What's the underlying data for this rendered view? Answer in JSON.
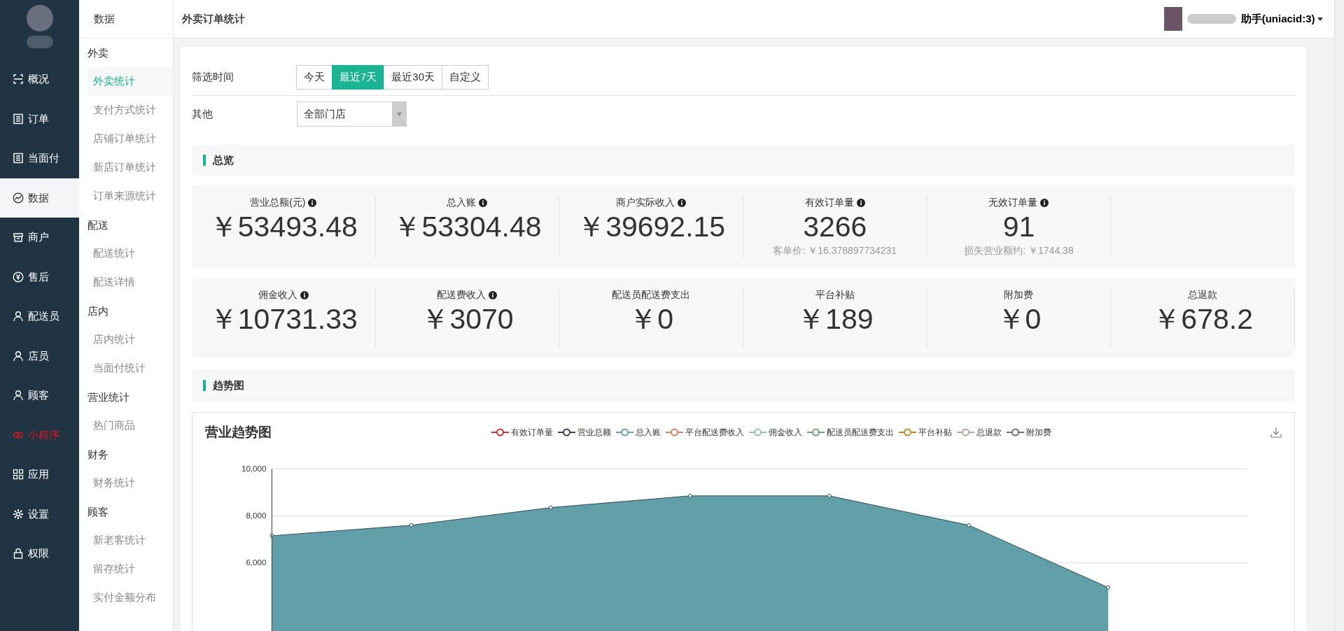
{
  "nav": [
    {
      "label": "概况",
      "selected": false,
      "hot": false
    },
    {
      "label": "订单",
      "selected": false,
      "hot": false
    },
    {
      "label": "当面付",
      "selected": false,
      "hot": false
    },
    {
      "label": "数据",
      "selected": true,
      "hot": false
    },
    {
      "label": "商户",
      "selected": false,
      "hot": false
    },
    {
      "label": "售后",
      "selected": false,
      "hot": false
    },
    {
      "label": "配送员",
      "selected": false,
      "hot": false
    },
    {
      "label": "店员",
      "selected": false,
      "hot": false
    },
    {
      "label": "顾客",
      "selected": false,
      "hot": false
    },
    {
      "label": "小程序",
      "selected": false,
      "hot": true
    },
    {
      "label": "应用",
      "selected": false,
      "hot": false
    },
    {
      "label": "设置",
      "selected": false,
      "hot": false
    },
    {
      "label": "权限",
      "selected": false,
      "hot": false
    }
  ],
  "subnav": {
    "title": "数据",
    "groups": [
      {
        "title": "外卖",
        "items": [
          {
            "label": "外卖统计",
            "selected": true
          },
          {
            "label": "支付方式统计",
            "selected": false
          },
          {
            "label": "店铺订单统计",
            "selected": false
          },
          {
            "label": "新店订单统计",
            "selected": false
          },
          {
            "label": "订单来源统计",
            "selected": false
          }
        ]
      },
      {
        "title": "配送",
        "items": [
          {
            "label": "配送统计",
            "selected": false
          },
          {
            "label": "配送详情",
            "selected": false
          }
        ]
      },
      {
        "title": "店内",
        "items": [
          {
            "label": "店内统计",
            "selected": false
          },
          {
            "label": "当面付统计",
            "selected": false
          }
        ]
      },
      {
        "title": "营业统计",
        "items": [
          {
            "label": "热门商品",
            "selected": false
          }
        ]
      },
      {
        "title": "财务",
        "items": [
          {
            "label": "财务统计",
            "selected": false
          }
        ]
      },
      {
        "title": "顾客",
        "items": [
          {
            "label": "新老客统计",
            "selected": false
          },
          {
            "label": "留存统计",
            "selected": false
          },
          {
            "label": "实付金额分布",
            "selected": false
          }
        ]
      }
    ]
  },
  "header": {
    "title": "外卖订单统计",
    "user": "助手(uniacid:3)"
  },
  "filters": {
    "time_label": "筛选时间",
    "ranges": [
      {
        "label": "今天",
        "selected": false
      },
      {
        "label": "最近7天",
        "selected": true
      },
      {
        "label": "最近30天",
        "selected": false
      },
      {
        "label": "自定义",
        "selected": false
      }
    ],
    "other_label": "其他",
    "store_select": "全部门店"
  },
  "overview": {
    "title": "总览",
    "rows": [
      [
        {
          "label": "营业总额(元)",
          "info": true,
          "value": "￥53493.48"
        },
        {
          "label": "总入账",
          "info": true,
          "value": "￥53304.48"
        },
        {
          "label": "商户实际收入",
          "info": true,
          "value": "￥39692.15"
        },
        {
          "label": "有效订单量",
          "info": true,
          "value": "3266",
          "note": "客单价: ￥16.378897734231"
        },
        {
          "label": "无效订单量",
          "info": true,
          "value": "91",
          "note": "损失营业额约: ￥1744.38"
        }
      ],
      [
        {
          "label": "佣金收入",
          "info": true,
          "value": "￥10731.33"
        },
        {
          "label": "配送费收入",
          "info": true,
          "value": "￥3070"
        },
        {
          "label": "配送员配送费支出",
          "info": false,
          "value": "￥0"
        },
        {
          "label": "平台补贴",
          "info": false,
          "value": "￥189"
        },
        {
          "label": "附加费",
          "info": false,
          "value": "￥0"
        },
        {
          "label": "总退款",
          "info": false,
          "value": "￥678.2"
        }
      ]
    ]
  },
  "trend": {
    "title": "趋势图",
    "chart_data": {
      "type": "area",
      "title": "营业趋势图",
      "ylim": [
        0,
        10000
      ],
      "yticks": [
        {
          "value": 6000,
          "label": "6,000"
        },
        {
          "value": 8000,
          "label": "8,000"
        },
        {
          "value": 10000,
          "label": "10,000"
        }
      ],
      "series": [
        {
          "name": "有效订单量",
          "color": "#c23531"
        },
        {
          "name": "营业总额",
          "color": "#2f4554"
        },
        {
          "name": "总入账",
          "color": "#61a0a8",
          "values": [
            7150,
            7600,
            8350,
            8850,
            8850,
            7600,
            4950
          ]
        },
        {
          "name": "平台配送费收入",
          "color": "#d48265"
        },
        {
          "name": "佣金收入",
          "color": "#91c7ae"
        },
        {
          "name": "配送员配送费支出",
          "color": "#749f83"
        },
        {
          "name": "平台补贴",
          "color": "#ca8622"
        },
        {
          "name": "总退款",
          "color": "#bda29a"
        },
        {
          "name": "附加费",
          "color": "#6e7074"
        }
      ]
    }
  }
}
